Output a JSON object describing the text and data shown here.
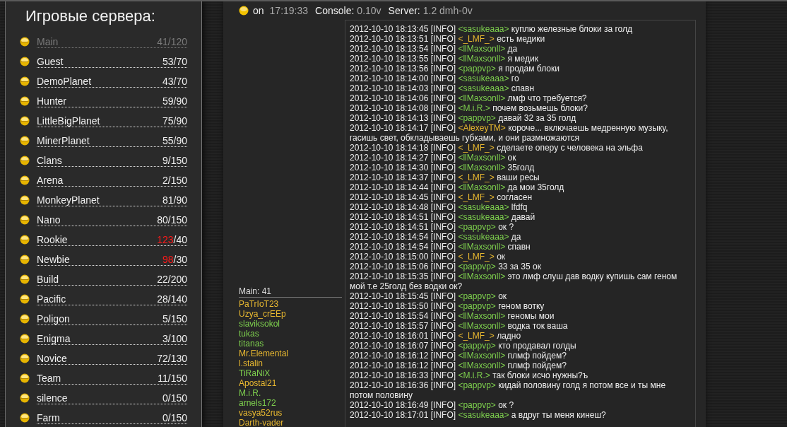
{
  "sidebar": {
    "title": "Игровые сервера:",
    "servers": [
      {
        "name": "Main",
        "count": "41",
        "max": "/120",
        "over": false,
        "selected": true
      },
      {
        "name": "Guest",
        "count": "53",
        "max": "/70",
        "over": false,
        "selected": false
      },
      {
        "name": "DemoPlanet",
        "count": "43",
        "max": "/70",
        "over": false,
        "selected": false
      },
      {
        "name": "Hunter",
        "count": "59",
        "max": "/90",
        "over": false,
        "selected": false
      },
      {
        "name": "LittleBigPlanet",
        "count": "75",
        "max": "/90",
        "over": false,
        "selected": false
      },
      {
        "name": "MinerPlanet",
        "count": "55",
        "max": "/90",
        "over": false,
        "selected": false
      },
      {
        "name": "Clans",
        "count": "9",
        "max": "/150",
        "over": false,
        "selected": false
      },
      {
        "name": "Arena",
        "count": "2",
        "max": "/150",
        "over": false,
        "selected": false
      },
      {
        "name": "MonkeyPlanet",
        "count": "81",
        "max": "/90",
        "over": false,
        "selected": false
      },
      {
        "name": "Nano",
        "count": "80",
        "max": "/150",
        "over": false,
        "selected": false
      },
      {
        "name": "Rookie",
        "count": "123",
        "max": "/40",
        "over": true,
        "selected": false
      },
      {
        "name": "Newbie",
        "count": "98",
        "max": "/30",
        "over": true,
        "selected": false
      },
      {
        "name": "Build",
        "count": "22",
        "max": "/200",
        "over": false,
        "selected": false
      },
      {
        "name": "Pacific",
        "count": "28",
        "max": "/140",
        "over": false,
        "selected": false
      },
      {
        "name": "Poligon",
        "count": "5",
        "max": "/150",
        "over": false,
        "selected": false
      },
      {
        "name": "Enigma",
        "count": "3",
        "max": "/100",
        "over": false,
        "selected": false
      },
      {
        "name": "Novice",
        "count": "72",
        "max": "/130",
        "over": false,
        "selected": false
      },
      {
        "name": "Team",
        "count": "11",
        "max": "/150",
        "over": false,
        "selected": false
      },
      {
        "name": "silence",
        "count": "0",
        "max": "/150",
        "over": false,
        "selected": false
      },
      {
        "name": "Farm",
        "count": "0",
        "max": "/150",
        "over": false,
        "selected": false
      }
    ]
  },
  "status_bar": {
    "state": "on",
    "time": "17:19:33",
    "console_label": "Console:",
    "console_version": "0.10v",
    "server_label": "Server:",
    "server_version": "1.2 dmh-0v"
  },
  "players": {
    "header": "Main: 41",
    "list": [
      {
        "name": "PaTrIoT23",
        "color": "#e8b830"
      },
      {
        "name": "Uzya_crEEp",
        "color": "#e8b830"
      },
      {
        "name": "slaviksokol",
        "color": "#7ed04e"
      },
      {
        "name": "tukas",
        "color": "#7ed04e"
      },
      {
        "name": "titanas",
        "color": "#7ed04e"
      },
      {
        "name": "Mr.Elemental",
        "color": "#e8b830"
      },
      {
        "name": "l.stalin",
        "color": "#e8b830"
      },
      {
        "name": "TiRaNiX",
        "color": "#7ed04e"
      },
      {
        "name": "Apostal21",
        "color": "#e8b830"
      },
      {
        "name": "M.i.R.",
        "color": "#7ed04e"
      },
      {
        "name": "arnels172",
        "color": "#7ed04e"
      },
      {
        "name": "vasya52rus",
        "color": "#e8b830"
      },
      {
        "name": "Darth-vader",
        "color": "#e8b830"
      }
    ]
  },
  "log": [
    {
      "stamp": "2012-10-10 18:13:45 [INFO]",
      "nick": "<sasukeaaa>",
      "color": "#7ed04e",
      "text": "куплю железные блоки за голд"
    },
    {
      "stamp": "2012-10-10 18:13:51 [INFO]",
      "nick": "<_LMF_>",
      "color": "#e8b830",
      "text": "есть медики"
    },
    {
      "stamp": "2012-10-10 18:13:54 [INFO]",
      "nick": "<llMaxsonll>",
      "color": "#7ed04e",
      "text": "да"
    },
    {
      "stamp": "2012-10-10 18:13:55 [INFO]",
      "nick": "<llMaxsonll>",
      "color": "#7ed04e",
      "text": "я медик"
    },
    {
      "stamp": "2012-10-10 18:13:56 [INFO]",
      "nick": "<pappvp>",
      "color": "#7ed04e",
      "text": "я продам блоки"
    },
    {
      "stamp": "2012-10-10 18:14:00 [INFO]",
      "nick": "<sasukeaaa>",
      "color": "#7ed04e",
      "text": "го"
    },
    {
      "stamp": "2012-10-10 18:14:03 [INFO]",
      "nick": "<sasukeaaa>",
      "color": "#7ed04e",
      "text": "спавн"
    },
    {
      "stamp": "2012-10-10 18:14:06 [INFO]",
      "nick": "<llMaxsonll>",
      "color": "#7ed04e",
      "text": "лмф что требуется?"
    },
    {
      "stamp": "2012-10-10 18:14:08 [INFO]",
      "nick": "<M.i.R.>",
      "color": "#7ed04e",
      "text": "почем возьмешь блоки?"
    },
    {
      "stamp": "2012-10-10 18:14:13 [INFO]",
      "nick": "<pappvp>",
      "color": "#7ed04e",
      "text": "давай 32 за 35 голд"
    },
    {
      "stamp": "2012-10-10 18:14:17 [INFO]",
      "nick": "<AlexeyTM>",
      "color": "#e8b830",
      "text": "короче... включаешь медренную музыку, гасишь свет, обкладываешь губками, и они размножаются"
    },
    {
      "stamp": "2012-10-10 18:14:18 [INFO]",
      "nick": "<_LMF_>",
      "color": "#e8b830",
      "text": "сделаете оперу с человека на эльфа"
    },
    {
      "stamp": "2012-10-10 18:14:27 [INFO]",
      "nick": "<llMaxsonll>",
      "color": "#7ed04e",
      "text": "ок"
    },
    {
      "stamp": "2012-10-10 18:14:30 [INFO]",
      "nick": "<llMaxsonll>",
      "color": "#7ed04e",
      "text": "35голд"
    },
    {
      "stamp": "2012-10-10 18:14:37 [INFO]",
      "nick": "<_LMF_>",
      "color": "#e8b830",
      "text": "ваши ресы"
    },
    {
      "stamp": "2012-10-10 18:14:44 [INFO]",
      "nick": "<llMaxsonll>",
      "color": "#7ed04e",
      "text": "да мои 35голд"
    },
    {
      "stamp": "2012-10-10 18:14:45 [INFO]",
      "nick": "<_LMF_>",
      "color": "#e8b830",
      "text": "согласен"
    },
    {
      "stamp": "2012-10-10 18:14:48 [INFO]",
      "nick": "<sasukeaaa>",
      "color": "#7ed04e",
      "text": "lfdfq"
    },
    {
      "stamp": "2012-10-10 18:14:51 [INFO]",
      "nick": "<sasukeaaa>",
      "color": "#7ed04e",
      "text": "давай"
    },
    {
      "stamp": "2012-10-10 18:14:51 [INFO]",
      "nick": "<pappvp>",
      "color": "#7ed04e",
      "text": "ок ?"
    },
    {
      "stamp": "2012-10-10 18:14:54 [INFO]",
      "nick": "<sasukeaaa>",
      "color": "#7ed04e",
      "text": "да"
    },
    {
      "stamp": "2012-10-10 18:14:54 [INFO]",
      "nick": "<llMaxsonll>",
      "color": "#7ed04e",
      "text": "спавн"
    },
    {
      "stamp": "2012-10-10 18:15:00 [INFO]",
      "nick": "<_LMF_>",
      "color": "#e8b830",
      "text": "ок"
    },
    {
      "stamp": "2012-10-10 18:15:06 [INFO]",
      "nick": "<pappvp>",
      "color": "#7ed04e",
      "text": "33 за 35 ок"
    },
    {
      "stamp": "2012-10-10 18:15:35 [INFO]",
      "nick": "<llMaxsonll>",
      "color": "#7ed04e",
      "text": "это лмф слуш дав водку купишь сам геном мой т.е 25голд без водки ок?"
    },
    {
      "stamp": "2012-10-10 18:15:45 [INFO]",
      "nick": "<pappvp>",
      "color": "#7ed04e",
      "text": "ок"
    },
    {
      "stamp": "2012-10-10 18:15:50 [INFO]",
      "nick": "<pappvp>",
      "color": "#7ed04e",
      "text": "геном вотку"
    },
    {
      "stamp": "2012-10-10 18:15:54 [INFO]",
      "nick": "<llMaxsonll>",
      "color": "#7ed04e",
      "text": "геномы мои"
    },
    {
      "stamp": "2012-10-10 18:15:57 [INFO]",
      "nick": "<llMaxsonll>",
      "color": "#7ed04e",
      "text": "водка ток ваша"
    },
    {
      "stamp": "2012-10-10 18:16:01 [INFO]",
      "nick": "<_LMF_>",
      "color": "#e8b830",
      "text": "ладно"
    },
    {
      "stamp": "2012-10-10 18:16:07 [INFO]",
      "nick": "<pappvp>",
      "color": "#7ed04e",
      "text": "кто продавал голды"
    },
    {
      "stamp": "2012-10-10 18:16:12 [INFO]",
      "nick": "<llMaxsonll>",
      "color": "#7ed04e",
      "text": "плмф пойдем?"
    },
    {
      "stamp": "2012-10-10 18:16:12 [INFO]",
      "nick": "<llMaxsonll>",
      "color": "#7ed04e",
      "text": "плмф пойдем?"
    },
    {
      "stamp": "2012-10-10 18:16:33 [INFO]",
      "nick": "<M.i.R.>",
      "color": "#7ed04e",
      "text": "так блоки исчо нужны?ъ"
    },
    {
      "stamp": "2012-10-10 18:16:36 [INFO]",
      "nick": "<pappvp>",
      "color": "#7ed04e",
      "text": "кидай половину голд я потом все и ты мне потом половину"
    },
    {
      "stamp": "2012-10-10 18:16:49 [INFO]",
      "nick": "<pappvp>",
      "color": "#7ed04e",
      "text": "ок ?"
    },
    {
      "stamp": "2012-10-10 18:17:01 [INFO]",
      "nick": "<sasukeaaa>",
      "color": "#7ed04e",
      "text": "а вдруг ты меня кинеш?"
    }
  ]
}
